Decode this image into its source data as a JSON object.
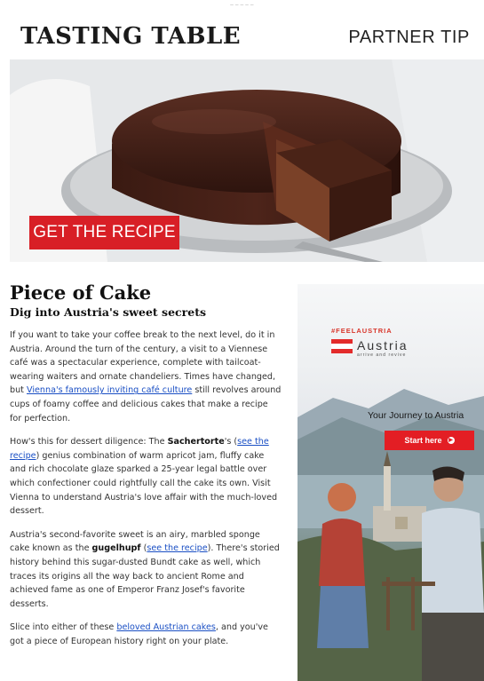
{
  "preheader": "— — — — —",
  "header": {
    "logo": "TASTING TABLE",
    "partner_tip": "PARTNER TIP"
  },
  "hero": {
    "cta_label": "GET THE RECIPE"
  },
  "article": {
    "title": "Piece of Cake",
    "subtitle": "Dig into Austria's sweet secrets",
    "p1": {
      "text_a": "If you want to take your coffee break to the next level, do it in Austria. Around the turn of the century, a visit to a Viennese café was a spectacular experience, complete with tailcoat-wearing waiters and ornate chandeliers. Times have changed, but ",
      "link": "Vienna's famously inviting café culture",
      "text_b": " still revolves around cups of foamy coffee and delicious cakes that make a recipe for perfection."
    },
    "p2": {
      "text_a": "How's this for dessert diligence: The ",
      "bold": "Sachertorte",
      "text_b": "'s (",
      "link": "see the recipe",
      "text_c": ") genius combination of warm apricot jam, fluffy cake and rich chocolate glaze sparked a 25-year legal battle over which confectioner could rightfully call the cake its own. Visit Vienna to understand Austria's love affair with the much-loved dessert."
    },
    "p3": {
      "text_a": "Austria's second-favorite sweet is an airy, marbled sponge cake known as the ",
      "bold": "gugelhupf",
      "text_b": " (",
      "link": "see the recipe",
      "text_c": "). There's storied history behind this sugar-dusted Bundt cake as well, which traces its origins all the way back to ancient Rome and achieved fame as one of Emperor Franz Josef's favorite desserts."
    },
    "p4": {
      "text_a": "Slice into either of these ",
      "link": "beloved Austrian cakes",
      "text_b": ", and you've got a piece of European history right on your plate."
    }
  },
  "ad": {
    "hashtag": "#FEELAUSTRIA",
    "brand": "Austria",
    "tagline": "arrive and revive",
    "journey": "Your Journey to Austria",
    "button": "Start here",
    "flag_colors": [
      "#e32b2b",
      "#ffffff",
      "#e32b2b"
    ]
  },
  "colors": {
    "accent_red": "#d81f26",
    "link_blue": "#1a4fc4"
  }
}
